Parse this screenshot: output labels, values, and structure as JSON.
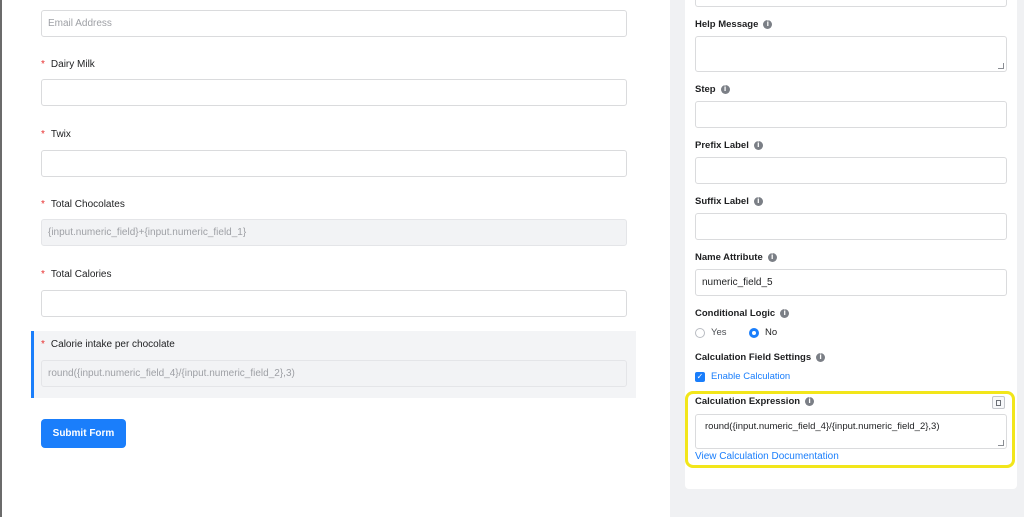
{
  "form": {
    "email_placeholder": "Email Address",
    "required_mark": "*",
    "fields": {
      "dairy_milk": {
        "label": "Dairy Milk",
        "value": ""
      },
      "twix": {
        "label": "Twix",
        "value": ""
      },
      "total_chocolates": {
        "label": "Total Chocolates",
        "value": "{input.numeric_field}+{input.numeric_field_1}"
      },
      "total_calories": {
        "label": "Total Calories",
        "value": ""
      },
      "calorie_intake": {
        "label": "Calorie intake per chocolate",
        "value": "round({input.numeric_field_4}/{input.numeric_field_2},3)"
      }
    },
    "submit_label": "Submit Form"
  },
  "settings": {
    "help_message": {
      "label": "Help Message",
      "value": ""
    },
    "step": {
      "label": "Step",
      "value": ""
    },
    "prefix_label": {
      "label": "Prefix Label",
      "value": ""
    },
    "suffix_label": {
      "label": "Suffix Label",
      "value": ""
    },
    "name_attribute": {
      "label": "Name Attribute",
      "value": "numeric_field_5"
    },
    "conditional_logic": {
      "label": "Conditional Logic",
      "options": [
        "Yes",
        "No"
      ],
      "selected": "No"
    },
    "calculation_settings": {
      "label": "Calculation Field Settings",
      "checkbox_label": "Enable Calculation",
      "checked": true
    },
    "calculation_expression": {
      "label": "Calculation Expression",
      "value": "round({input.numeric_field_4}/{input.numeric_field_2},3)"
    },
    "doc_link": "View Calculation Documentation"
  },
  "icons": {
    "info": "info-icon",
    "calc": "calculator-icon",
    "check": "checkmark-icon"
  },
  "colors": {
    "accent": "#1a7efb",
    "required": "#e72f2f",
    "highlight": "#f2e61a"
  }
}
